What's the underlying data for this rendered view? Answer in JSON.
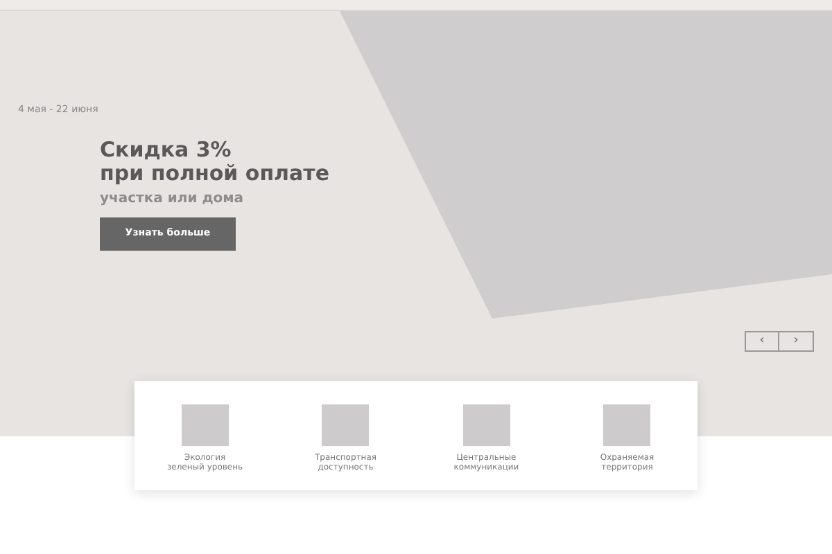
{
  "hero": {
    "date": "4 мая - 22 июня",
    "title_lines": [
      "Скидка 3%",
      "при полной оплате"
    ],
    "subtitle": "участка или дома",
    "button": "Узнать больше",
    "prev": "‹",
    "next": "›"
  },
  "features": [
    {
      "label_lines": [
        "Экология",
        "зеленый уровень"
      ]
    },
    {
      "label_lines": [
        "Транспортная",
        "доступность"
      ]
    },
    {
      "label_lines": [
        "Центральные",
        "коммуникации"
      ]
    },
    {
      "label_lines": [
        "Охраняемая",
        "территория"
      ]
    }
  ]
}
